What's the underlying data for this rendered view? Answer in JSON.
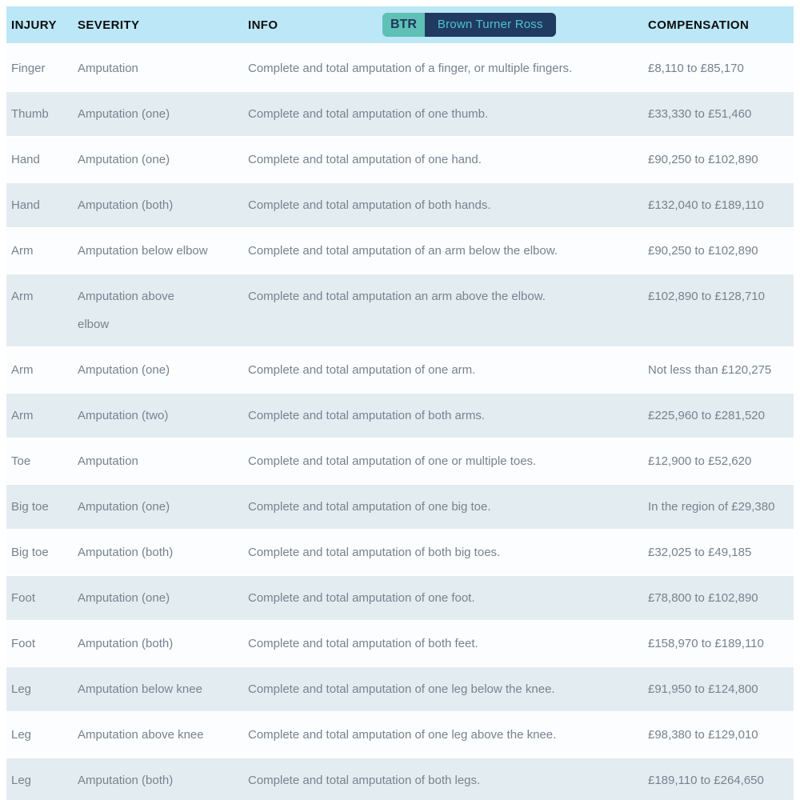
{
  "brand": {
    "initials": "BTR",
    "name": "Brown Turner Ross"
  },
  "colors": {
    "header_bg": "#bce7f6",
    "row_light": "#fbfdfe",
    "row_dark": "#e3edf1",
    "body_text": "#76828f",
    "header_text": "#0d0e10",
    "badge_teal": "#5fc0b5",
    "badge_navy": "#203a60",
    "badge_name_text": "#4ec3ce"
  },
  "table": {
    "columns": [
      "INJURY",
      "SEVERITY",
      "INFO",
      "COMPENSATION"
    ],
    "rows": [
      {
        "injury": "Finger",
        "severity": "Amputation",
        "info": "Complete and total amputation of a finger, or multiple fingers.",
        "compensation": "£8,110 to £85,170"
      },
      {
        "injury": "Thumb",
        "severity": "Amputation (one)",
        "info": "Complete and total amputation of one thumb.",
        "compensation": "£33,330 to £51,460"
      },
      {
        "injury": "Hand",
        "severity": "Amputation (one)",
        "info": "Complete and total amputation of one hand.",
        "compensation": "£90,250 to £102,890"
      },
      {
        "injury": "Hand",
        "severity": "Amputation (both)",
        "info": "Complete and total amputation of both hands.",
        "compensation": "£132,040 to £189,110"
      },
      {
        "injury": "Arm",
        "severity": "Amputation below elbow",
        "info": "Complete and total amputation of an arm below the elbow.",
        "compensation": "£90,250 to £102,890"
      },
      {
        "injury": "Arm",
        "severity": "Amputation above\nelbow",
        "info": "Complete and total amputation an arm above the elbow.",
        "compensation": "£102,890 to £128,710"
      },
      {
        "injury": "Arm",
        "severity": "Amputation (one)",
        "info": "Complete and total amputation of one arm.",
        "compensation": "Not less than £120,275"
      },
      {
        "injury": "Arm",
        "severity": "Amputation (two)",
        "info": "Complete and total amputation of both arms.",
        "compensation": "£225,960 to £281,520"
      },
      {
        "injury": "Toe",
        "severity": "Amputation",
        "info": "Complete and total amputation of one or multiple toes.",
        "compensation": "£12,900 to £52,620"
      },
      {
        "injury": "Big toe",
        "severity": "Amputation (one)",
        "info": "Complete and total amputation of one big toe.",
        "compensation": "In the region of £29,380"
      },
      {
        "injury": "Big toe",
        "severity": "Amputation (both)",
        "info": "Complete and total amputation of both big toes.",
        "compensation": "£32,025 to £49,185"
      },
      {
        "injury": "Foot",
        "severity": "Amputation (one)",
        "info": "Complete and total amputation of one foot.",
        "compensation": "£78,800 to £102,890"
      },
      {
        "injury": "Foot",
        "severity": "Amputation (both)",
        "info": "Complete and total amputation of both feet.",
        "compensation": "£158,970 to £189,110"
      },
      {
        "injury": "Leg",
        "severity": "Amputation below knee",
        "info": "Complete and total amputation of one leg below the knee.",
        "compensation": "£91,950 to £124,800"
      },
      {
        "injury": "Leg",
        "severity": "Amputation above knee",
        "info": "Complete and total amputation of one leg above the knee.",
        "compensation": "£98,380 to £129,010"
      },
      {
        "injury": "Leg",
        "severity": "Amputation (both)",
        "info": "Complete and total amputation of both legs.",
        "compensation": "£189,110 to £264,650"
      }
    ]
  }
}
